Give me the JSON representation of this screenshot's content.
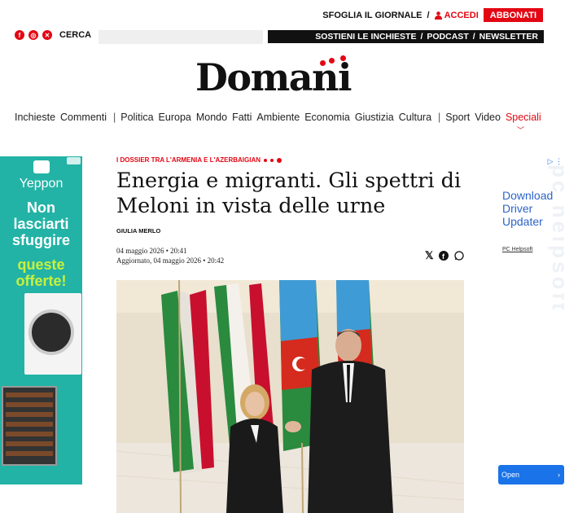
{
  "header": {
    "sfoglia": "SFOGLIA IL GIORNALE",
    "separator": "/",
    "accedi": "ACCEDI",
    "abbonati": "ABBONATI",
    "cerca": "CERCA",
    "promo_links": [
      "SOSTIENI LE INCHIESTE",
      "/",
      "PODCAST",
      "/",
      "NEWSLETTER"
    ],
    "logo": "Domani"
  },
  "nav": {
    "group1": [
      "Inchieste",
      "Commenti"
    ],
    "group2": [
      "Politica",
      "Europa",
      "Mondo",
      "Fatti",
      "Ambiente",
      "Economia",
      "Giustizia",
      "Cultura"
    ],
    "group3": [
      "Sport",
      "Video"
    ],
    "speciali": "Speciali",
    "divider": "|"
  },
  "article": {
    "kicker": "I DOSSIER TRA L'ARMENIA E L'AZERBAIGIAN",
    "title": "Energia e migranti. Gli spettri di Meloni in vista delle urne",
    "author": "GIULIA MERLO",
    "published": "04 maggio 2026 • 20:41",
    "updated": "Aggiornato, 04 maggio 2026 • 20:42"
  },
  "ad_left": {
    "brand": "Yeppon",
    "line1": "Non lasciarti sfuggire",
    "line2": "queste offerte!"
  },
  "ad_right": {
    "headline": "Download Driver Updater",
    "sponsor": "PC Helpsoft",
    "watermark": "pc helpsoft",
    "cta": "Open",
    "cta_arrow": "›"
  },
  "icons": {
    "social": [
      "facebook-icon",
      "instagram-icon",
      "x-icon"
    ],
    "share": [
      "x-icon",
      "facebook-icon",
      "whatsapp-icon"
    ]
  },
  "colors": {
    "accent": "#e30613",
    "ad_left_bg": "#22b3a6",
    "ad_right_link": "#2c64c8"
  }
}
